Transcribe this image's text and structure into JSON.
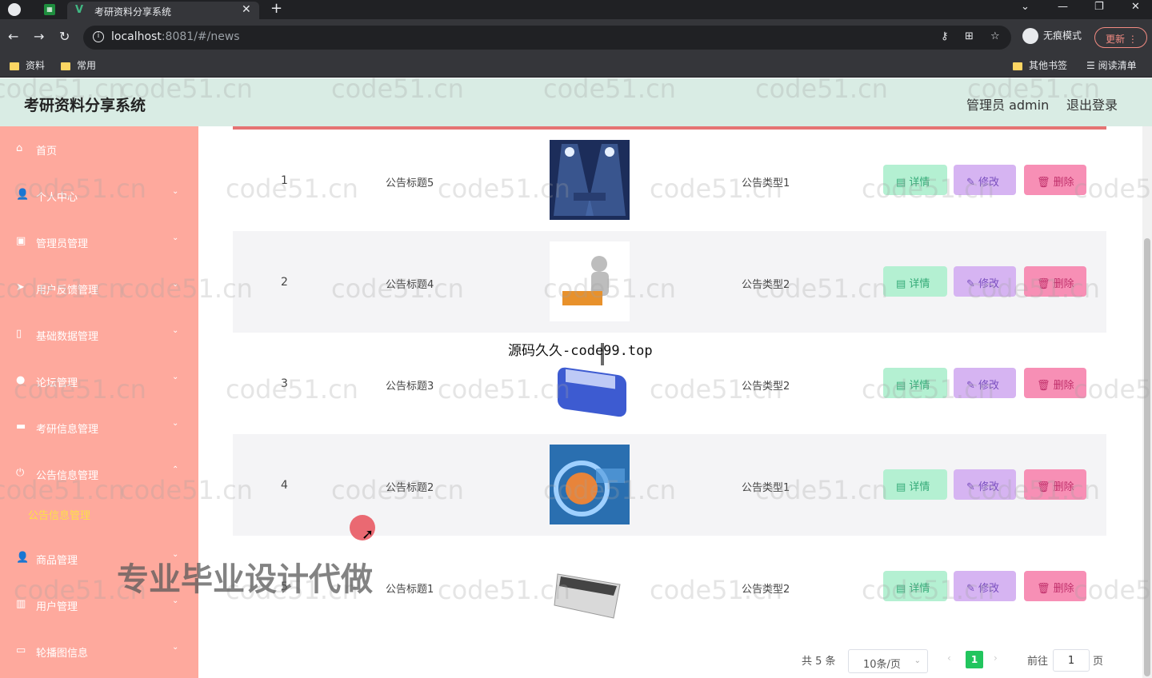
{
  "browser": {
    "tab_title": "考研资料分享系统",
    "tab_close": "✕",
    "new_tab": "+",
    "url_host": "localhost",
    "url_rest": ":8081/#/news",
    "incognito_label": "无痕模式",
    "update_label": "更新",
    "bookmarks": [
      "资料",
      "常用"
    ],
    "other_bookmarks": "其他书签",
    "reading_list": "阅读清单"
  },
  "header": {
    "title": "考研资料分享系统",
    "admin_label": "管理员 admin",
    "logout_label": "退出登录"
  },
  "sidebar": {
    "items": [
      {
        "label": "首页",
        "icon": "home-icon"
      },
      {
        "label": "个人中心",
        "icon": "user-icon"
      },
      {
        "label": "管理员管理",
        "icon": "briefcase-icon"
      },
      {
        "label": "用户反馈管理",
        "icon": "send-icon"
      },
      {
        "label": "基础数据管理",
        "icon": "mobile-icon"
      },
      {
        "label": "论坛管理",
        "icon": "location-icon"
      },
      {
        "label": "考研信息管理",
        "icon": "chat-icon"
      },
      {
        "label": "公告信息管理",
        "icon": "power-icon"
      },
      {
        "label": "商品管理",
        "icon": "user-icon"
      },
      {
        "label": "用户管理",
        "icon": "bar-chart-icon"
      },
      {
        "label": "轮播图信息",
        "icon": "message-icon"
      }
    ],
    "active_sub_item": "公告信息管理"
  },
  "table": {
    "rows": [
      {
        "index": "1",
        "title": "公告标题5",
        "type": "公告类型1",
        "image": "spotlight-news-image"
      },
      {
        "index": "2",
        "title": "公告标题4",
        "type": "公告类型2",
        "image": "news-3d-image"
      },
      {
        "index": "3",
        "title": "公告标题3",
        "type": "公告类型2",
        "image": "news-blue-key-image"
      },
      {
        "index": "4",
        "title": "公告标题2",
        "type": "公告类型1",
        "image": "globe-news-image"
      },
      {
        "index": "5",
        "title": "公告标题1",
        "type": "公告类型2",
        "image": "newspaper-image"
      }
    ],
    "actions": {
      "detail": "详情",
      "edit": "修改",
      "delete": "删除"
    }
  },
  "pagination": {
    "total": "共 5 条",
    "page_size": "10条/页",
    "current_page": "1",
    "goto_label": "前往",
    "goto_value": "1",
    "page_suffix": "页"
  },
  "overlays": {
    "watermark": "code51.cn",
    "source": "源码久久-code99.top",
    "ad": "专业毕业设计代做"
  },
  "colors": {
    "sidebar": "#fea99d",
    "header": "#d9ece4",
    "detail_btn": "#b4f0d2",
    "edit_btn": "#d6b4f2",
    "delete_btn": "#f78fb5",
    "page_active": "#22c55e"
  }
}
